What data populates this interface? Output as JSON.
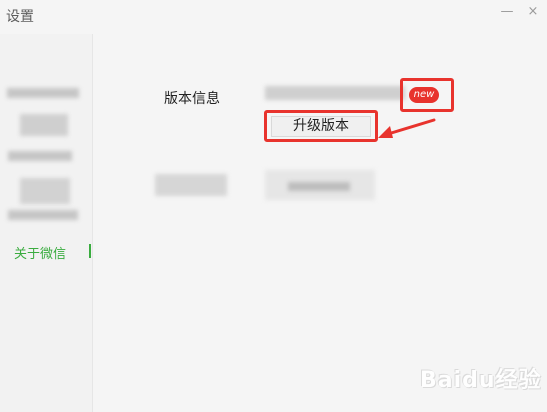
{
  "window": {
    "title": "设置",
    "minimize_glyph": "—",
    "close_glyph": "×"
  },
  "sidebar": {
    "items": [
      {
        "label": "关于微信",
        "selected": true
      }
    ],
    "accent_color": "#3aac3f"
  },
  "main": {
    "version_label": "版本信息",
    "new_badge": "new",
    "upgrade_button": "升级版本"
  },
  "annotation_color": "#e8332d",
  "watermark": "Baidu经验"
}
